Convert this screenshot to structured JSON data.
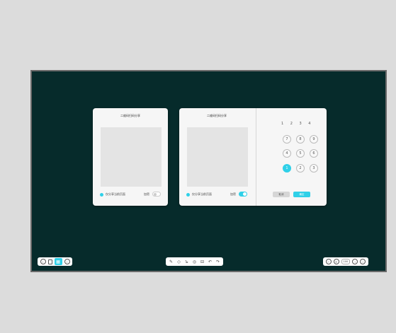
{
  "panel_left": {
    "title": "二维码扫码分享",
    "share_option": "仅分享当前页面",
    "encrypt_label": "加密",
    "encrypt_on": false
  },
  "panel_right": {
    "title": "二维码扫码分享",
    "share_option": "仅分享当前页面",
    "encrypt_label": "加密",
    "encrypt_on": true,
    "pin": "1 2 3 4",
    "keypad": [
      "7",
      "8",
      "9",
      "4",
      "5",
      "6",
      "1",
      "2",
      "3"
    ],
    "active_key": "1",
    "cancel_label": "取消",
    "confirm_label": "确定"
  },
  "toolbar_left": {
    "icons": [
      "back-icon",
      "page-icon",
      "grid-icon",
      "forward-icon"
    ],
    "selected": "grid-icon"
  },
  "toolbar_center": {
    "icons": [
      "pen-icon",
      "eraser-icon",
      "lasso-icon",
      "shape-icon",
      "bucket-icon",
      "undo-icon",
      "redo-icon"
    ]
  },
  "toolbar_right": {
    "zoom": "100",
    "icons": [
      "zoom-out-icon",
      "zoom-in-icon",
      "prev-icon",
      "next-icon"
    ]
  },
  "colors": {
    "board": "#062b2b",
    "accent": "#2fd0e8",
    "panel": "#f6f6f6"
  }
}
